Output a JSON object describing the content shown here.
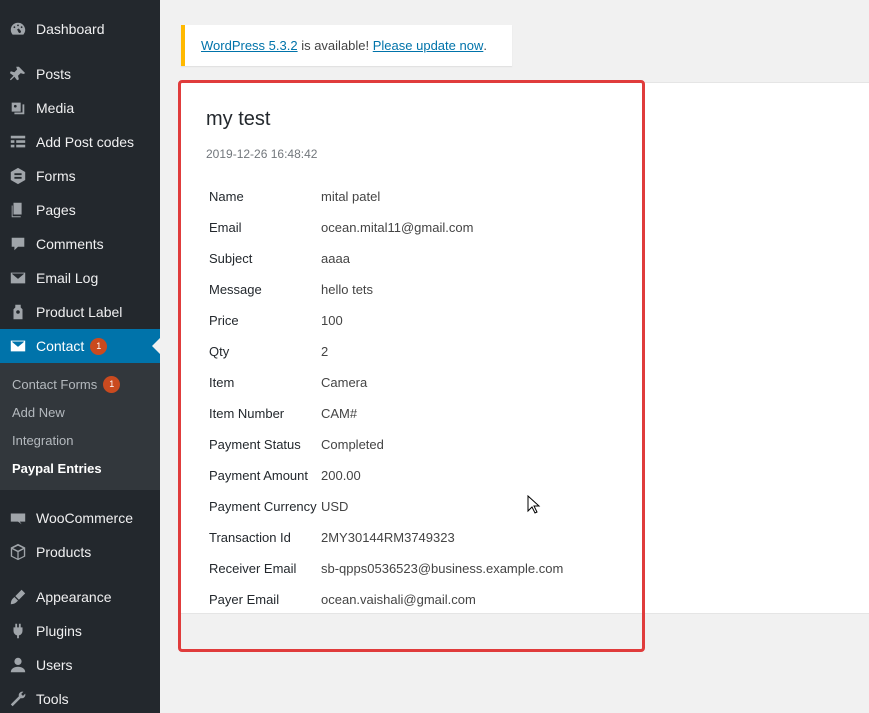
{
  "sidebar": {
    "menu": [
      {
        "label": "Dashboard",
        "icon": "dashboard-icon"
      },
      {
        "label": "Posts",
        "icon": "pin-icon"
      },
      {
        "label": "Media",
        "icon": "media-icon"
      },
      {
        "label": "Add Post codes",
        "icon": "grid-icon"
      },
      {
        "label": "Forms",
        "icon": "forms-icon"
      },
      {
        "label": "Pages",
        "icon": "pages-icon"
      },
      {
        "label": "Comments",
        "icon": "comment-icon"
      },
      {
        "label": "Email Log",
        "icon": "email-icon"
      },
      {
        "label": "Product Label",
        "icon": "label-icon"
      },
      {
        "label": "Contact",
        "icon": "envelope-icon",
        "badge": "1"
      },
      {
        "label": "WooCommerce",
        "icon": "woo-icon"
      },
      {
        "label": "Products",
        "icon": "box-icon"
      },
      {
        "label": "Appearance",
        "icon": "brush-icon"
      },
      {
        "label": "Plugins",
        "icon": "plug-icon"
      },
      {
        "label": "Users",
        "icon": "user-icon"
      },
      {
        "label": "Tools",
        "icon": "wrench-icon"
      }
    ],
    "submenu": [
      {
        "label": "Contact Forms",
        "badge": "1"
      },
      {
        "label": "Add New"
      },
      {
        "label": "Integration"
      },
      {
        "label": "Paypal Entries"
      }
    ]
  },
  "notice": {
    "link1": "WordPress 5.3.2",
    "middle": " is available! ",
    "link2": "Please update now",
    "end": "."
  },
  "entry": {
    "title": "my test",
    "date": "2019-12-26 16:48:42",
    "fields": [
      {
        "label": "Name",
        "value": "mital patel"
      },
      {
        "label": "Email",
        "value": "ocean.mital11@gmail.com"
      },
      {
        "label": "Subject",
        "value": "aaaa"
      },
      {
        "label": "Message",
        "value": "hello tets"
      },
      {
        "label": "Price",
        "value": "100"
      },
      {
        "label": "Qty",
        "value": "2"
      },
      {
        "label": "Item",
        "value": "Camera"
      },
      {
        "label": "Item Number",
        "value": "CAM#"
      },
      {
        "label": "Payment Status",
        "value": "Completed"
      },
      {
        "label": "Payment Amount",
        "value": "200.00"
      },
      {
        "label": "Payment Currency",
        "value": "USD"
      },
      {
        "label": "Transaction Id",
        "value": "2MY30144RM3749323"
      },
      {
        "label": "Receiver Email",
        "value": "sb-qpps0536523@business.example.com"
      },
      {
        "label": "Payer Email",
        "value": "ocean.vaishali@gmail.com"
      }
    ]
  },
  "colors": {
    "sidebar_bg": "#23282d",
    "active_bg": "#0073aa",
    "badge_bg": "#ca4a1f",
    "notice_border": "#ffb900",
    "highlight_border": "#e03c3c"
  }
}
